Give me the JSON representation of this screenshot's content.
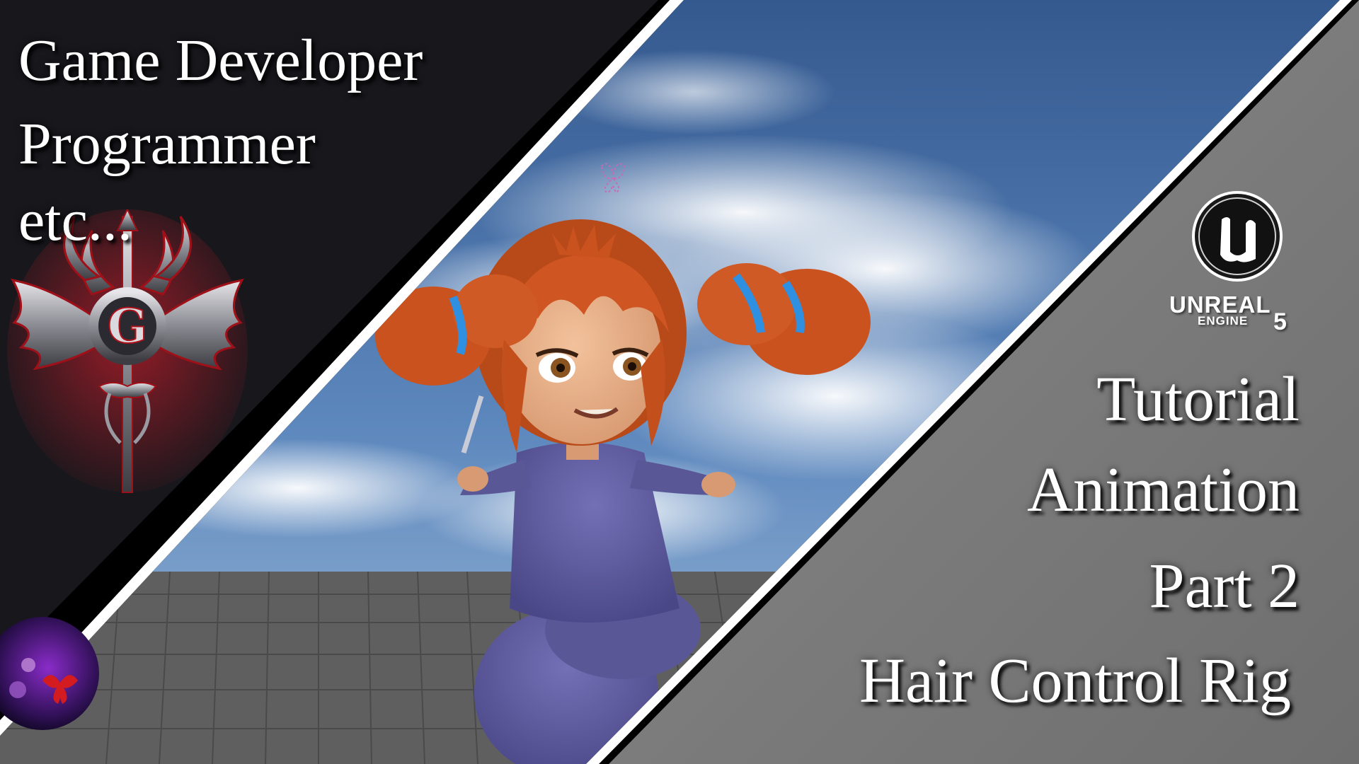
{
  "left_panel": {
    "line1": "Game Developer",
    "line2": "Programmer",
    "line3": "etc..."
  },
  "right_panel": {
    "line1": "Tutorial",
    "line2": "Animation",
    "line3": "Part 2",
    "line4": "Hair Control Rig"
  },
  "engine_logo": {
    "brand": "UNREAL",
    "sub": "ENGINE",
    "version": "5"
  },
  "colors": {
    "left_bg": "#17171c",
    "right_bg": "#7c7c7c",
    "sky": "#3d6ea8",
    "cloud": "#dfe7f1",
    "hair": "#c9521f",
    "ribbon": "#2f8fe0",
    "outfit": "#5d5a9c",
    "stripe": "#ffffff",
    "emblem_red": "#c01a22"
  },
  "icons": {
    "left_emblem": "winged-trident-g-emblem-icon",
    "engine": "unreal-engine-logo-icon",
    "corner": "butterfly-orb-icon"
  }
}
